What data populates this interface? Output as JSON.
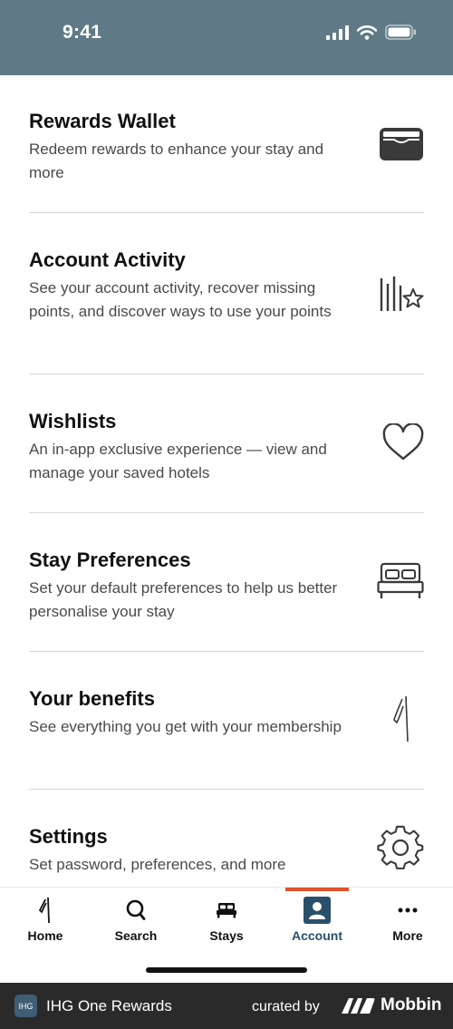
{
  "status_bar": {
    "time": "9:41"
  },
  "menu": [
    {
      "title": "Rewards Wallet",
      "description": "Redeem rewards to enhance your stay and more",
      "icon": "wallet-icon"
    },
    {
      "title": "Account Activity",
      "description": "See your account activity, recover missing points, and discover ways to use your points",
      "icon": "activity-star-icon"
    },
    {
      "title": "Wishlists",
      "description": "An in-app exclusive experience — view and manage your saved hotels",
      "icon": "heart-icon"
    },
    {
      "title": "Stay Preferences",
      "description": "Set your default preferences to help us better personalise your stay",
      "icon": "bed-icon"
    },
    {
      "title": "Your benefits",
      "description": "See everything you get with your membership",
      "icon": "ihg-logo-icon"
    },
    {
      "title": "Settings",
      "description": "Set password, preferences, and more",
      "icon": "gear-icon"
    }
  ],
  "tabs": [
    {
      "label": "Home",
      "icon": "ihg-logo-icon"
    },
    {
      "label": "Search",
      "icon": "search-icon"
    },
    {
      "label": "Stays",
      "icon": "bed-icon"
    },
    {
      "label": "Account",
      "icon": "account-icon",
      "active": true
    },
    {
      "label": "More",
      "icon": "more-dots-icon"
    }
  ],
  "footer": {
    "logo_text": "IHG",
    "app_name": "IHG One Rewards",
    "curated_by": "curated by",
    "brand": "Mobbin"
  },
  "colors": {
    "status_bar": "#5f7a86",
    "active_tab": "#2a4f6a",
    "tab_indicator": "#e0532b",
    "footer_bg": "#2a2a2a"
  }
}
